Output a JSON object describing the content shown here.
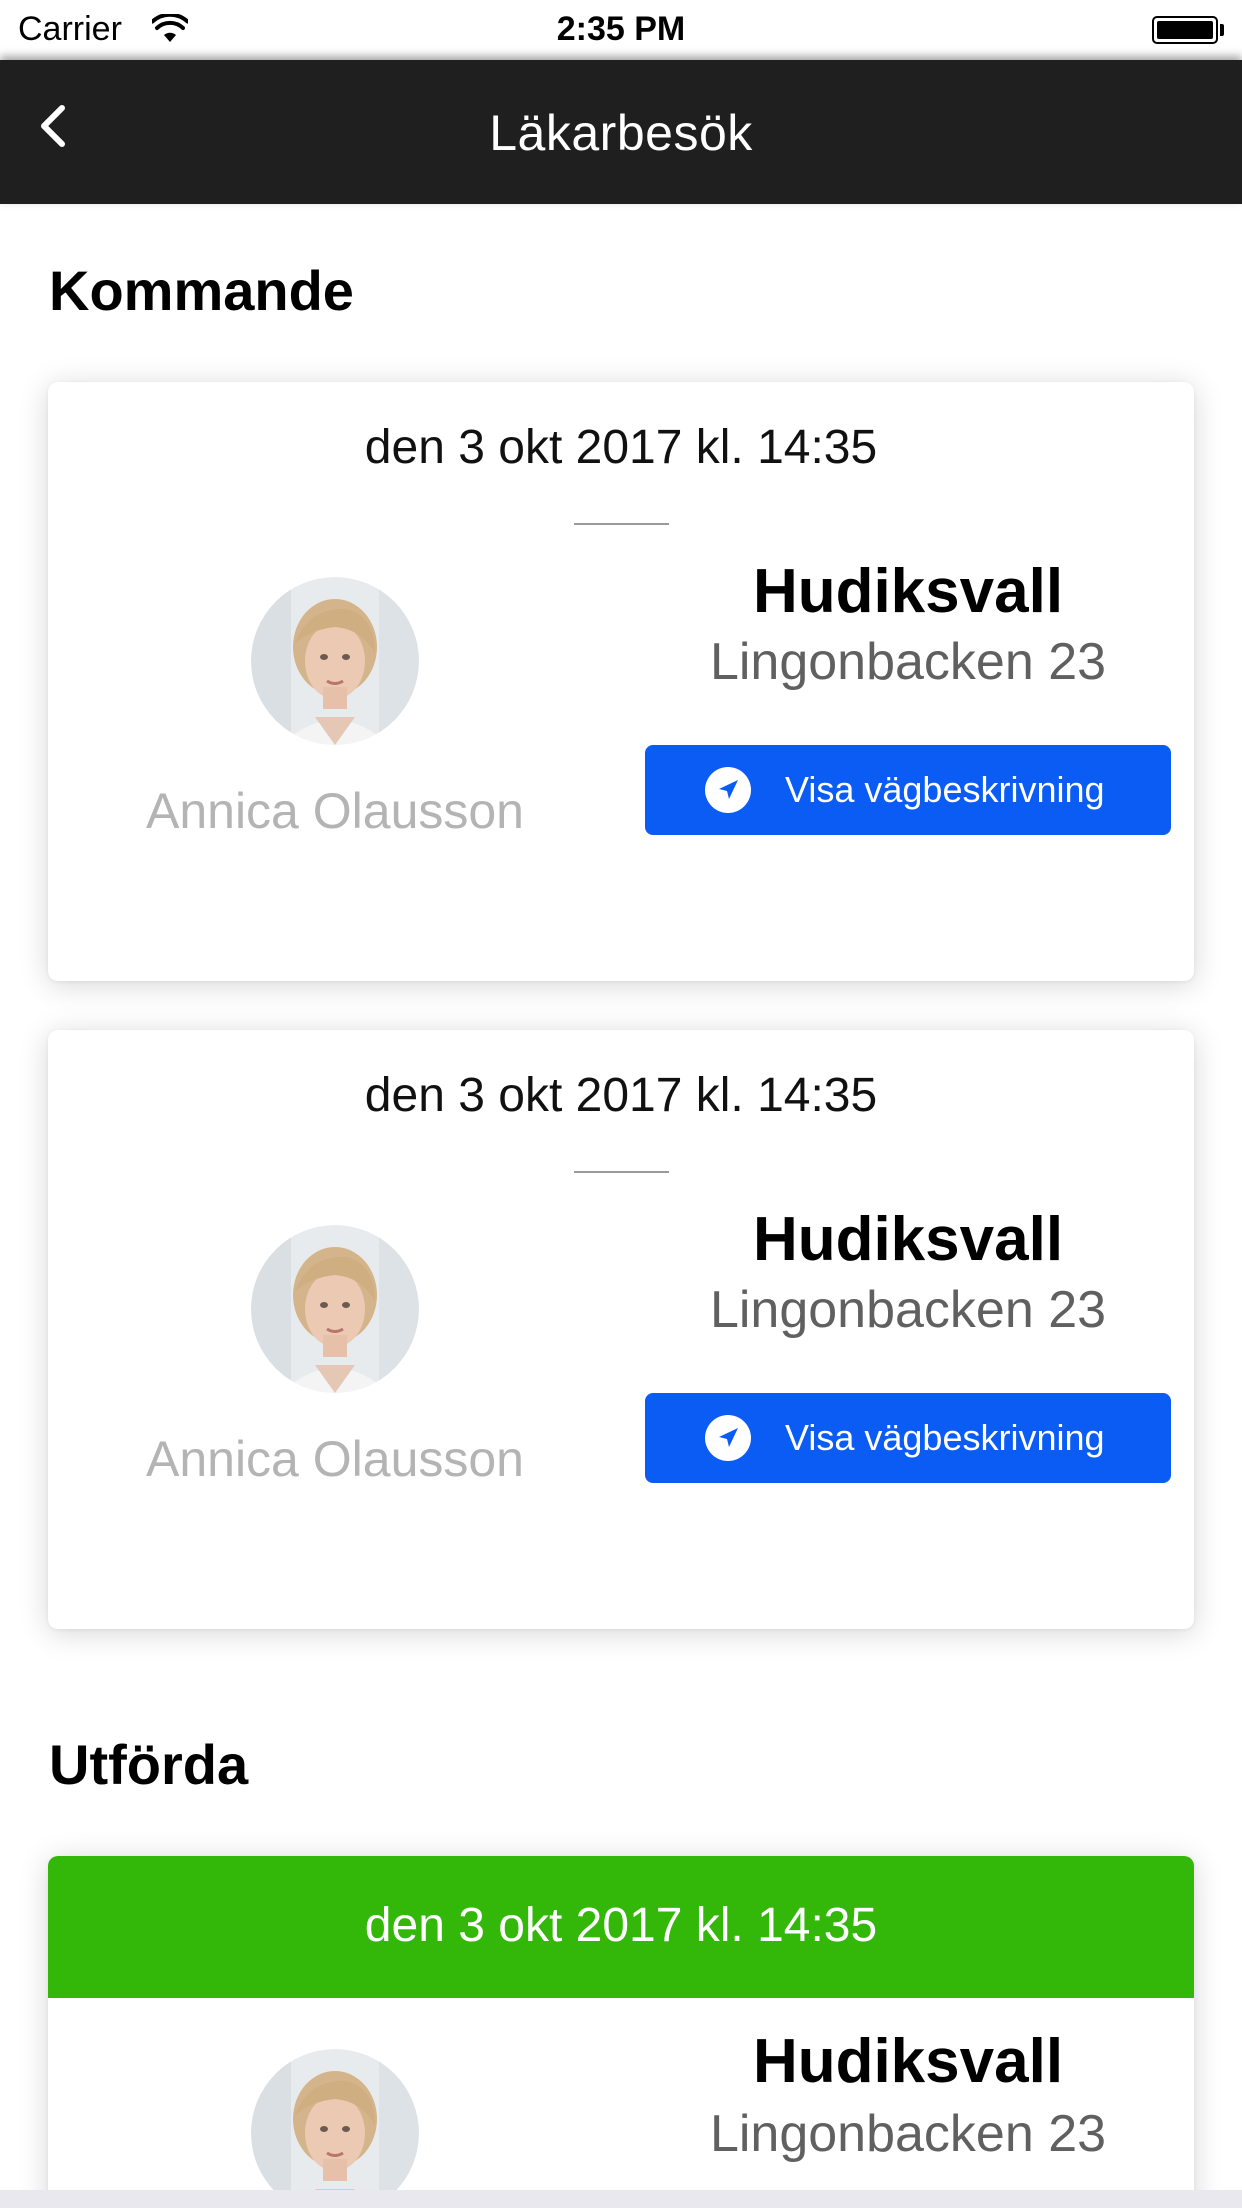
{
  "status_bar": {
    "carrier": "Carrier",
    "time": "2:35 PM"
  },
  "nav": {
    "title": "Läkarbesök",
    "back_icon": "chevron-left-icon"
  },
  "sections": {
    "upcoming_title": "Kommande",
    "completed_title": "Utförda"
  },
  "upcoming": [
    {
      "date": "den 3 okt 2017 kl. 14:35",
      "doctor": "Annica Olausson",
      "city": "Hudiksvall",
      "street": "Lingonbacken 23",
      "directions_label": "Visa vägbeskrivning",
      "directions_icon": "navigation-arrow-icon"
    },
    {
      "date": "den 3 okt 2017 kl. 14:35",
      "doctor": "Annica Olausson",
      "city": "Hudiksvall",
      "street": "Lingonbacken 23",
      "directions_label": "Visa vägbeskrivning",
      "directions_icon": "navigation-arrow-icon"
    }
  ],
  "completed": [
    {
      "date": "den 3 okt 2017 kl. 14:35",
      "city": "Hudiksvall",
      "street": "Lingonbacken 23"
    }
  ],
  "colors": {
    "nav_bg": "#1f1f1f",
    "button_blue": "#0b5cf5",
    "completed_green": "#33b80a"
  }
}
